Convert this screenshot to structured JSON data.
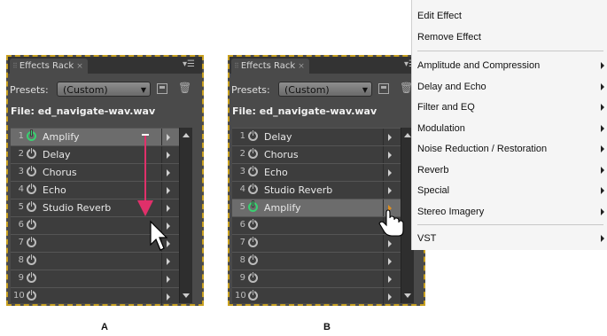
{
  "colors": {
    "accent": "#e0306a",
    "highlight_border": "#c8a020",
    "power_on": "#38d070"
  },
  "panels": [
    {
      "id": "A",
      "tab_title": "Effects Rack",
      "presets_label": "Presets:",
      "presets_value": "(Custom)",
      "file_label": "File: ed_navigate-wav.wav",
      "caption": "A",
      "rows": [
        {
          "num": "1",
          "name": "Amplify",
          "on": true,
          "selected": true
        },
        {
          "num": "2",
          "name": "Delay",
          "on": false
        },
        {
          "num": "3",
          "name": "Chorus",
          "on": false
        },
        {
          "num": "4",
          "name": "Echo",
          "on": false
        },
        {
          "num": "5",
          "name": "Studio Reverb",
          "on": false
        },
        {
          "num": "6",
          "name": "",
          "on": false
        },
        {
          "num": "7",
          "name": "",
          "on": false
        },
        {
          "num": "8",
          "name": "",
          "on": false
        },
        {
          "num": "9",
          "name": "",
          "on": false
        },
        {
          "num": "10",
          "name": "",
          "on": false
        }
      ]
    },
    {
      "id": "B",
      "tab_title": "Effects Rack",
      "presets_label": "Presets:",
      "presets_value": "(Custom)",
      "file_label": "File: ed_navigate-wav.wav",
      "caption": "B",
      "rows": [
        {
          "num": "1",
          "name": "Delay",
          "on": false
        },
        {
          "num": "2",
          "name": "Chorus",
          "on": false
        },
        {
          "num": "3",
          "name": "Echo",
          "on": false
        },
        {
          "num": "4",
          "name": "Studio Reverb",
          "on": false
        },
        {
          "num": "5",
          "name": "Amplify",
          "on": true,
          "selected": true,
          "hot": true
        },
        {
          "num": "6",
          "name": "",
          "on": false
        },
        {
          "num": "7",
          "name": "",
          "on": false
        },
        {
          "num": "8",
          "name": "",
          "on": false
        },
        {
          "num": "9",
          "name": "",
          "on": false
        },
        {
          "num": "10",
          "name": "",
          "on": false
        }
      ]
    }
  ],
  "context_menu": {
    "items": [
      {
        "label": "Edit Effect",
        "submenu": false
      },
      {
        "label": "Remove Effect",
        "submenu": false
      },
      {
        "separator": true
      },
      {
        "label": "Amplitude and Compression",
        "submenu": true
      },
      {
        "label": "Delay and Echo",
        "submenu": true
      },
      {
        "label": "Filter and EQ",
        "submenu": true
      },
      {
        "label": "Modulation",
        "submenu": true
      },
      {
        "label": "Noise Reduction / Restoration",
        "submenu": true
      },
      {
        "label": "Reverb",
        "submenu": true
      },
      {
        "label": "Special",
        "submenu": true
      },
      {
        "label": "Stereo Imagery",
        "submenu": true
      },
      {
        "separator": true
      },
      {
        "label": "VST",
        "submenu": true
      }
    ]
  }
}
